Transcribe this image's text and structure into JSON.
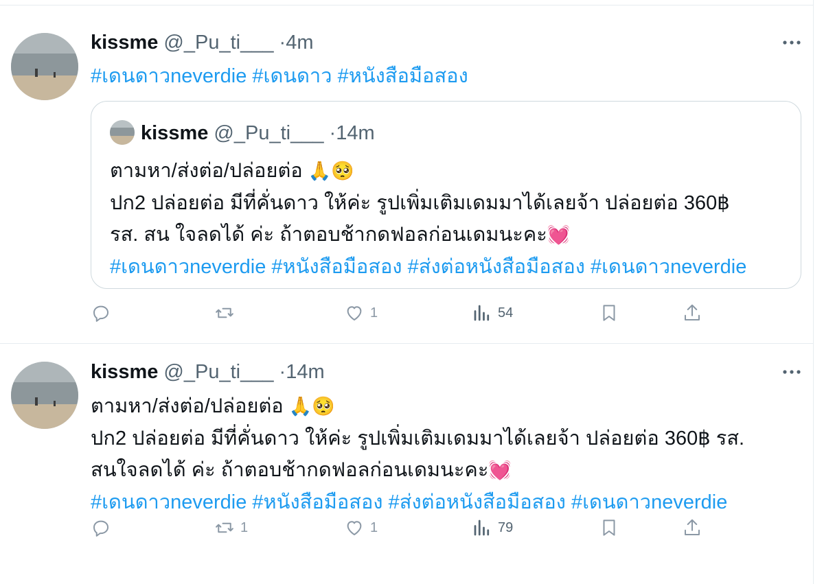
{
  "tweets": [
    {
      "author": {
        "name": "kissme",
        "handle": "@_Pu_ti___",
        "time": "4m"
      },
      "hashtags": [
        "#เดนดาวneverdie",
        "#เดนดาว",
        "#หนังสือมือสอง"
      ],
      "quote": {
        "author": {
          "name": "kissme",
          "handle": "@_Pu_ti___",
          "time": "14m"
        },
        "lines": [
          "ตามหา/ส่งต่อ/ปล่อยต่อ",
          "ปก2 ปล่อยต่อ  มีที่คั่นดาว ให้ค่ะ รูปเพิ่มเติมเดมมาได้เลยจ้า ปล่อยต่อ 360฿",
          "รส. สน ใจลดได้ ค่ะ ถ้าตอบช้ากดฟอลก่อนเดมนะคะ"
        ],
        "hashtags": [
          "#เดนดาวneverdie",
          "#หนังสือมือสอง",
          "#ส่งต่อหนังสือมือสอง",
          "#เดนดาวneverdie"
        ]
      },
      "stats": {
        "reply": "",
        "retweet": "",
        "like": "1",
        "views": "54"
      }
    },
    {
      "author": {
        "name": "kissme",
        "handle": "@_Pu_ti___",
        "time": "14m"
      },
      "lines": [
        "ตามหา/ส่งต่อ/ปล่อยต่อ",
        "ปก2 ปล่อยต่อ  มีที่คั่นดาว ให้ค่ะ รูปเพิ่มเติมเดมมาได้เลยจ้า ปล่อยต่อ 360฿ รส.",
        "สนใจลดได้ ค่ะ ถ้าตอบช้ากดฟอลก่อนเดมนะคะ"
      ],
      "hashtags": [
        "#เดนดาวneverdie",
        "#หนังสือมือสอง",
        "#ส่งต่อหนังสือมือสอง",
        "#เดนดาวneverdie"
      ],
      "stats": {
        "reply": "",
        "retweet": "1",
        "like": "1",
        "views": "79"
      }
    }
  ],
  "emojis": {
    "folded_hands": "🙏",
    "pleading_face": "🥺",
    "growing_heart": "💓"
  },
  "icons": [
    "reply-icon",
    "retweet-icon",
    "like-icon",
    "views-icon",
    "bookmark-icon",
    "share-icon",
    "more-icon"
  ],
  "colors": {
    "link": "#1d9bf0",
    "secondary_text": "#536471",
    "icon": "#8b98a5",
    "border": "#cfd9de"
  }
}
